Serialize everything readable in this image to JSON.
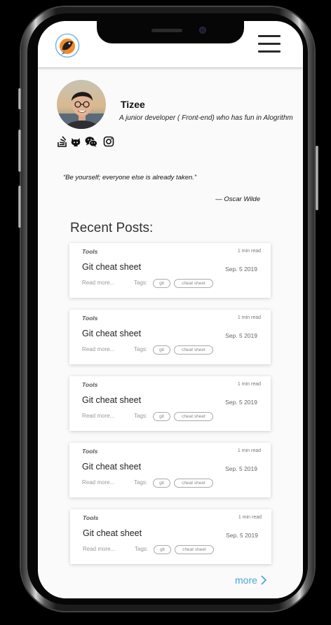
{
  "profile": {
    "name": "Tizee",
    "bio": "A junior developer ( Front-end) who has fun in Alogrithm"
  },
  "header": {
    "logo_icon": "parrot-logo-icon",
    "menu_icon": "hamburger-menu-icon"
  },
  "social_icons": [
    "stackoverflow-icon",
    "github-icon",
    "wechat-icon",
    "instagram-icon"
  ],
  "quote": {
    "text": "“Be yourself; everyone else is already taken.”",
    "author": "— Oscar Wilde"
  },
  "recent_posts": {
    "title": "Recent Posts:",
    "posts": [
      {
        "category": "Tools",
        "read_time": "1 min  read",
        "title": "Git cheat sheet",
        "date": "Sep. 5   2019",
        "read_more": "Read more...",
        "tags_label": "Tags:",
        "tags": [
          "git",
          "cheat sheet"
        ]
      },
      {
        "category": "Tools",
        "read_time": "1 min  read",
        "title": "Git cheat sheet",
        "date": "Sep. 5   2019",
        "read_more": "Read more...",
        "tags_label": "Tags:",
        "tags": [
          "git",
          "cheat sheet"
        ]
      },
      {
        "category": "Tools",
        "read_time": "1 min  read",
        "title": "Git cheat sheet",
        "date": "Sep. 5   2019",
        "read_more": "Read more...",
        "tags_label": "Tags:",
        "tags": [
          "git",
          "cheat sheet"
        ]
      },
      {
        "category": "Tools",
        "read_time": "1 min  read",
        "title": "Git cheat sheet",
        "date": "Sep. 5   2019",
        "read_more": "Read more...",
        "tags_label": "Tags:",
        "tags": [
          "git",
          "cheat sheet"
        ]
      },
      {
        "category": "Tools",
        "read_time": "1 min  read",
        "title": "Git cheat sheet",
        "date": "Sep. 5   2019",
        "read_more": "Read more...",
        "tags_label": "Tags:",
        "tags": [
          "git",
          "cheat sheet"
        ]
      }
    ],
    "more_label": "more"
  },
  "colors": {
    "accent_link": "#4aa6db",
    "screen_bg": "#fafafa",
    "card_bg": "#ffffff"
  }
}
